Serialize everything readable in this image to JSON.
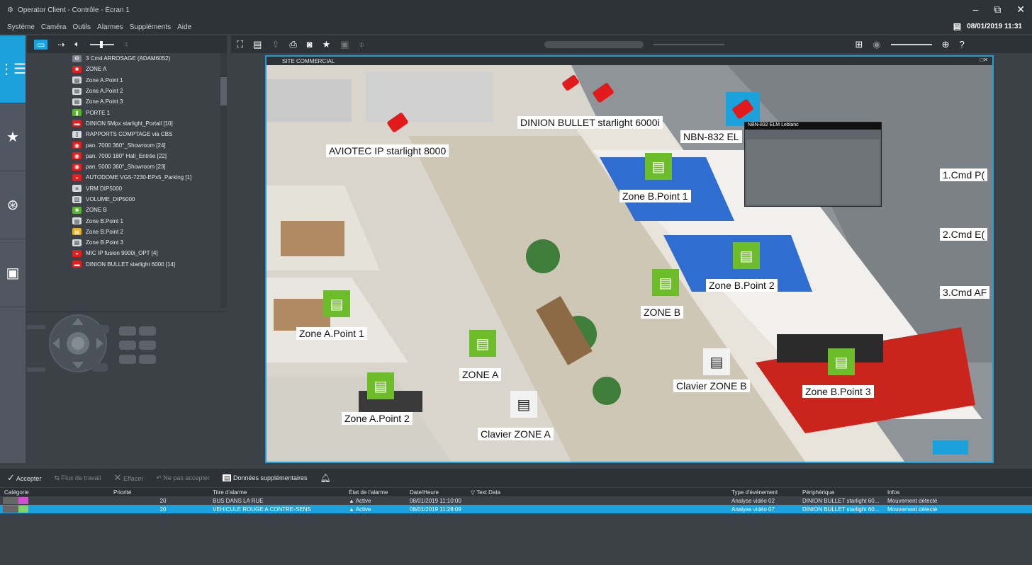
{
  "window": {
    "title": "Operator Client - Contrôle - Écran 1"
  },
  "menu": [
    "Système",
    "Caméra",
    "Outils",
    "Alarmes",
    "Suppléments",
    "Aide"
  ],
  "clock": "08/01/2019 11:31",
  "tree_items": [
    {
      "label": "3 Cmd ARROSAGE (ADAM6052)",
      "icon": "gear",
      "color": "#7a8088"
    },
    {
      "label": "ZONE A",
      "icon": "zone",
      "color": "#e02020"
    },
    {
      "label": "Zone A.Point 1",
      "icon": "point",
      "color": "#d6dade"
    },
    {
      "label": "Zone A.Point 2",
      "icon": "point",
      "color": "#d6dade"
    },
    {
      "label": "Zone A.Point 3",
      "icon": "point",
      "color": "#d6dade"
    },
    {
      "label": "PORTE 1",
      "icon": "door",
      "color": "#5cb531"
    },
    {
      "label": "DINION 5Mpx starlight_Portail [10]",
      "icon": "camera",
      "color": "#e02020"
    },
    {
      "label": "RAPPORTS COMPTAGE via CBS",
      "icon": "doc",
      "color": "#d6dade"
    },
    {
      "label": "pan. 7000 360°_Showroom [24]",
      "icon": "dome",
      "color": "#e02020"
    },
    {
      "label": "pan. 7000 180° Hall_Entrée [22]",
      "icon": "dome",
      "color": "#e02020"
    },
    {
      "label": "pan. 5000 360°_Showroom [23]",
      "icon": "dome",
      "color": "#e02020"
    },
    {
      "label": "AUTODOME VG5-7230-EPx5_Parking [1]",
      "icon": "ptz",
      "color": "#e02020"
    },
    {
      "label": "VRM DIP5000",
      "icon": "storage",
      "color": "#d6dade"
    },
    {
      "label": "VOLUME_DIP5000",
      "icon": "volume",
      "color": "#d6dade"
    },
    {
      "label": "ZONE B",
      "icon": "zone",
      "color": "#5cb531"
    },
    {
      "label": "Zone B.Point 1",
      "icon": "point",
      "color": "#d6dade"
    },
    {
      "label": "Zone B.Point 2",
      "icon": "point",
      "color": "#e0b020"
    },
    {
      "label": "Zone B.Point 3",
      "icon": "point",
      "color": "#d6dade"
    },
    {
      "label": "MIC IP fusion 9000i_OPT [4]",
      "icon": "ptz",
      "color": "#e02020"
    },
    {
      "label": "DINION BULLET starlight 6000 [14]",
      "icon": "camera",
      "color": "#e02020"
    }
  ],
  "viewer": {
    "title": "SITE COMMERCIAL"
  },
  "map_labels": {
    "aviotec": "AVIOTEC IP starlight 8000",
    "dinion": "DINION BULLET starlight 6000i",
    "nbn": "NBN-832 EL",
    "zb1": "Zone B.Point 1",
    "zb2": "Zone B.Point 2",
    "zb3": "Zone B.Point 3",
    "zoneb": "ZONE B",
    "za1": "Zone A.Point 1",
    "za2": "Zone A.Point 2",
    "zonea": "ZONE A",
    "clavierb": "Clavier ZONE B",
    "claviera": "Clavier ZONE A",
    "cmd1": "1.Cmd P(",
    "cmd2": "2.Cmd E(",
    "cmd3": "3.Cmd AF"
  },
  "inset_title": "NBN-832 ELM Leblanc",
  "alarm_toolbar": {
    "accept": "Accepter",
    "workflow": "Flux de travail",
    "clear": "Effacer",
    "unaccept": "Ne pas accepter",
    "extra": "Données supplémentaires"
  },
  "alarm_headers": [
    "Catégorie",
    "Priorité",
    "Titre d'alarme",
    "État de l'alarme",
    "Date/Heure",
    "Text Data",
    "Type d'événement",
    "Périphérique",
    "Infos"
  ],
  "alarms": [
    {
      "priority": "20",
      "title": "BUS DANS LA RUE",
      "state": "Active",
      "datetime": "08/01/2019 11:10:00",
      "text": "",
      "event": "Analyse vidéo 02",
      "device": "DINION BULLET starlight 60...",
      "info": "Mouvement détecté",
      "catcolor": "#d24fd2"
    },
    {
      "priority": "20",
      "title": "VEHICULE ROUGE A CONTRE-SENS",
      "state": "Active",
      "datetime": "08/01/2019 11:28:09",
      "text": "",
      "event": "Analyse vidéo 07",
      "device": "DINION BULLET starlight 60...",
      "info": "Mouvement détecté",
      "catcolor": "#7ed36a"
    }
  ]
}
